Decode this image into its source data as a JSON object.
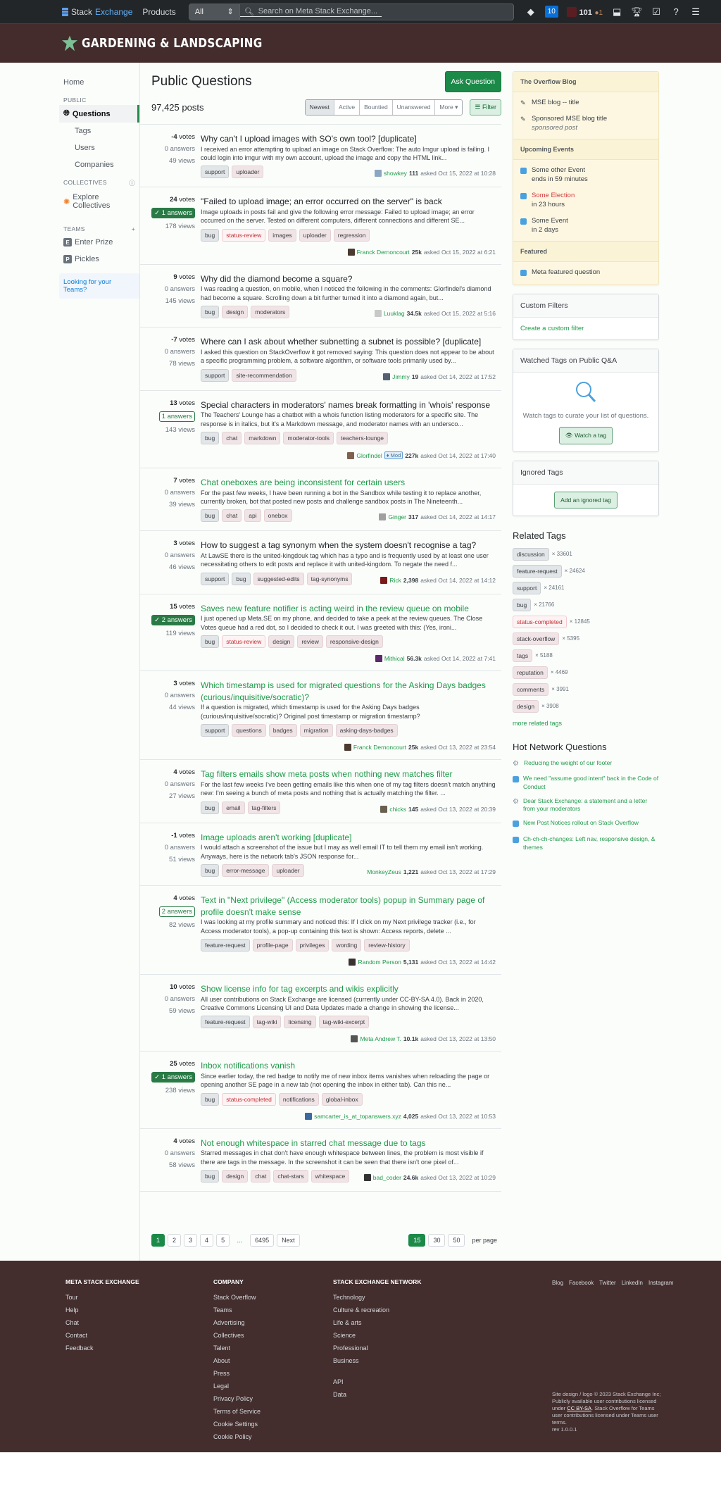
{
  "topbar": {
    "brand_a": "Stack",
    "brand_b": "Exchange",
    "products": "Products",
    "search_scope": "All",
    "search_placeholder": "Search on Meta Stack Exchange...",
    "notifications_count": "10",
    "reputation": "101",
    "bronze_badges": "1",
    "icons": [
      "diamond-icon",
      "inbox-icon",
      "achievements-icon",
      "review-icon",
      "help-icon",
      "site-switcher-icon"
    ]
  },
  "banner": {
    "site_name": "GARDENING & LANDSCAPING"
  },
  "leftnav": {
    "home": "Home",
    "public_label": "PUBLIC",
    "questions": "Questions",
    "tags": "Tags",
    "users": "Users",
    "companies": "Companies",
    "collectives_label": "COLLECTIVES",
    "explore_collectives": "Explore Collectives",
    "teams_label": "TEAMS",
    "teams": [
      {
        "icon": "E",
        "name": "Enter Prize"
      },
      {
        "icon": "P",
        "name": "Pickles"
      }
    ],
    "looking_teams": "Looking for your Teams?"
  },
  "main": {
    "title": "Public Questions",
    "ask_button": "Ask Question",
    "post_count": "97,425 posts",
    "sorts": [
      "Newest",
      "Active",
      "Bountied",
      "Unanswered",
      "More ▾"
    ],
    "active_sort": "Newest",
    "filter_button": "Filter",
    "questions": [
      {
        "votes": "-4",
        "answers": "0 answers",
        "answer_state": "none",
        "views": "49 views",
        "title": "Why can't I upload images with SO's own tool? [duplicate]",
        "visited": false,
        "excerpt": "I received an error attempting to upload an image on Stack Overflow: The auto Imgur upload is failing. I could login into imgur with my own account, upload the image and copy the HTML link...",
        "tags": [
          [
            "support",
            "g"
          ],
          [
            "uploader",
            ""
          ]
        ],
        "user": "showkey",
        "rep": "111",
        "asked": "asked Oct 15, 2022 at 10:28",
        "avatar": "#8aa6c0"
      },
      {
        "votes": "24",
        "answers": "1 answers",
        "answer_state": "accepted",
        "views": "178 views",
        "title": "\"Failed to upload image; an error occurred on the server\" is back",
        "visited": false,
        "excerpt": "Image uploads in posts fail and give the following error message: Failed to upload image; an error occurred on the server. Tested on different computers, different connections and different SE...",
        "tags": [
          [
            "bug",
            "g"
          ],
          [
            "status-review",
            "r"
          ],
          [
            "images",
            ""
          ],
          [
            "uploader",
            ""
          ],
          [
            "regression",
            ""
          ]
        ],
        "user": "Franck Dernoncourt",
        "rep": "25k",
        "asked": "asked Oct 15, 2022 at 6:21",
        "avatar": "#4a3a30"
      },
      {
        "votes": "9",
        "answers": "0 answers",
        "answer_state": "none",
        "views": "145 views",
        "title": "Why did the diamond become a square?",
        "visited": false,
        "excerpt": "I was reading a question, on mobile, when I noticed the following in the comments: Glorfindel's diamond had become a square. Scrolling down a bit further turned it into a diamond again, but...",
        "tags": [
          [
            "bug",
            "g"
          ],
          [
            "design",
            ""
          ],
          [
            "moderators",
            ""
          ]
        ],
        "user": "Luuklag",
        "rep": "34.5k",
        "asked": "asked Oct 15, 2022 at 5:16",
        "avatar": "#c8c8c8"
      },
      {
        "votes": "-7",
        "answers": "0 answers",
        "answer_state": "none",
        "views": "78 views",
        "title": "Where can I ask about whether subnetting a subnet is possible? [duplicate]",
        "visited": false,
        "excerpt": "I asked this question on StackOverflow it got removed saying: This question does not appear to be about a specific programming problem, a software algorithm, or software tools primarily used by...",
        "tags": [
          [
            "support",
            "g"
          ],
          [
            "site-recommendation",
            ""
          ]
        ],
        "user": "Jimmy",
        "rep": "19",
        "asked": "asked Oct 14, 2022 at 17:52",
        "avatar": "#556070"
      },
      {
        "votes": "13",
        "answers": "1 answers",
        "answer_state": "answered",
        "views": "143 views",
        "title": "Special characters in moderators' names break formatting in 'whois' response",
        "visited": false,
        "excerpt": "The Teachers' Lounge has a chatbot with a whois function listing moderators for a specific site. The response is in italics, but it's a Markdown message, and moderator names with an undersco...",
        "tags": [
          [
            "bug",
            "g"
          ],
          [
            "chat",
            ""
          ],
          [
            "markdown",
            ""
          ],
          [
            "moderator-tools",
            ""
          ],
          [
            "teachers-lounge",
            ""
          ]
        ],
        "user": "Glorfindel",
        "mod": "♦ Mod",
        "rep": "227k",
        "asked": "asked Oct 14, 2022 at 17:40",
        "avatar": "#806050"
      },
      {
        "votes": "7",
        "answers": "0 answers",
        "answer_state": "none",
        "views": "39 views",
        "title": "Chat oneboxes are being inconsistent for certain users",
        "visited": true,
        "excerpt": "For the past few weeks, I have been running a bot in the Sandbox while testing it to replace another, currently broken, bot that posted new posts and challenge sandbox posts in The Nineteenth...",
        "tags": [
          [
            "bug",
            "g"
          ],
          [
            "chat",
            ""
          ],
          [
            "api",
            ""
          ],
          [
            "onebox",
            ""
          ]
        ],
        "user": "Ginger",
        "rep": "317",
        "asked": "asked Oct 14, 2022 at 14:17",
        "avatar": "#a0a0a0"
      },
      {
        "votes": "3",
        "answers": "0 answers",
        "answer_state": "none",
        "views": "46 views",
        "title": "How to suggest a tag synonym when the system doesn't recognise a tag?",
        "visited": false,
        "excerpt": "At LawSE there is the united-kingdouk tag which has a typo and is frequently used by at least one user necessitating others to edit posts and replace it with united-kingdom. To negate the need f...",
        "tags": [
          [
            "support",
            "g"
          ],
          [
            "bug",
            "g"
          ],
          [
            "suggested-edits",
            ""
          ],
          [
            "tag-synonyms",
            ""
          ]
        ],
        "user": "Rick",
        "rep": "2,398",
        "asked": "asked Oct 14, 2022 at 14:12",
        "avatar": "#7a1a1a"
      },
      {
        "votes": "15",
        "answers": "2 answers",
        "answer_state": "accepted",
        "views": "119 views",
        "title": "Saves new feature notifier is acting weird in the review queue on mobile",
        "visited": true,
        "excerpt": "I just opened up Meta.SE on my phone, and decided to take a peek at the review queues. The Close Votes queue had a red dot, so I decided to check it out. I was greeted with this: (Yes, ironi...",
        "tags": [
          [
            "bug",
            "g"
          ],
          [
            "status-review",
            "r"
          ],
          [
            "design",
            ""
          ],
          [
            "review",
            ""
          ],
          [
            "responsive-design",
            ""
          ]
        ],
        "user": "Mithical",
        "rep": "56.3k",
        "asked": "asked Oct 14, 2022 at 7:41",
        "avatar": "#5a2a6a"
      },
      {
        "votes": "3",
        "answers": "0 answers",
        "answer_state": "none",
        "views": "44 views",
        "title": "Which timestamp is used for migrated questions for the Asking Days badges (curious/inquisitive/socratic)?",
        "visited": true,
        "excerpt": "If a question is migrated, which timestamp is used for the Asking Days badges (curious/inquisitive/socratic)? Original post timestamp or migration timestamp?",
        "tags": [
          [
            "support",
            "g"
          ],
          [
            "questions",
            ""
          ],
          [
            "badges",
            ""
          ],
          [
            "migration",
            ""
          ],
          [
            "asking-days-badges",
            ""
          ]
        ],
        "user": "Franck Dernoncourt",
        "rep": "25k",
        "asked": "asked Oct 13, 2022 at 23:54",
        "avatar": "#4a3a30"
      },
      {
        "votes": "4",
        "answers": "0 answers",
        "answer_state": "none",
        "views": "27 views",
        "title": "Tag filters emails show meta posts when nothing new matches filter",
        "visited": true,
        "excerpt": "For the last few weeks I've been getting emails like this when one of my tag filters doesn't match anything new: I'm seeing a bunch of meta posts and nothing that is actually matching the filter. ...",
        "tags": [
          [
            "bug",
            "g"
          ],
          [
            "email",
            ""
          ],
          [
            "tag-filters",
            ""
          ]
        ],
        "user": "chicks",
        "rep": "145",
        "asked": "asked Oct 13, 2022 at 20:39",
        "avatar": "#6a6050"
      },
      {
        "votes": "-1",
        "answers": "0 answers",
        "answer_state": "none",
        "views": "51 views",
        "title": "Image uploads aren't working [duplicate]",
        "visited": true,
        "excerpt": "I would attach a screenshot of the issue but I may as well email IT to tell them my email isn't working. Anyways, here is the network tab's JSON response for...",
        "tags": [
          [
            "bug",
            "g"
          ],
          [
            "error-message",
            ""
          ],
          [
            "uploader",
            ""
          ]
        ],
        "user": "MonkeyZeus",
        "rep": "1,221",
        "asked": "asked Oct 13, 2022 at 17:29",
        "avatar": ""
      },
      {
        "votes": "4",
        "answers": "2 answers",
        "answer_state": "answered",
        "views": "82 views",
        "title": "Text in \"Next privilege\" (Access moderator tools) popup in Summary page of profile doesn't make sense",
        "visited": true,
        "excerpt": "I was looking at my profile summary and noticed this: If I click on my Next privilege tracker (i.e., for Access moderator tools), a pop-up containing this text is shown: Access reports, delete ...",
        "tags": [
          [
            "feature-request",
            "g"
          ],
          [
            "profile-page",
            ""
          ],
          [
            "privileges",
            ""
          ],
          [
            "wording",
            ""
          ],
          [
            "review-history",
            ""
          ]
        ],
        "user": "Random Person",
        "rep": "5,131",
        "asked": "asked Oct 13, 2022 at 14:42",
        "avatar": "#3a3030"
      },
      {
        "votes": "10",
        "answers": "0 answers",
        "answer_state": "none",
        "views": "59 views",
        "title": "Show license info for tag excerpts and wikis explicitly",
        "visited": true,
        "excerpt": "All user contributions on Stack Exchange are licensed (currently under CC-BY-SA 4.0). Back in 2020, Creative Commons Licensing UI and Data Updates made a change in showing the license...",
        "tags": [
          [
            "feature-request",
            "g"
          ],
          [
            "tag-wiki",
            ""
          ],
          [
            "licensing",
            ""
          ],
          [
            "tag-wiki-excerpt",
            ""
          ]
        ],
        "user": "Meta Andrew T.",
        "rep": "10.1k",
        "asked": "asked Oct 13, 2022 at 13:50",
        "avatar": "#555"
      },
      {
        "votes": "25",
        "answers": "1 answers",
        "answer_state": "accepted",
        "views": "238 views",
        "title": "Inbox notifications vanish",
        "visited": true,
        "excerpt": "Since earlier today, the red badge to notify me of new inbox items vanishes when reloading the page or opening another SE page in a new tab (not opening the inbox in either tab). Can this ne...",
        "tags": [
          [
            "bug",
            "g"
          ],
          [
            "status-completed",
            "r"
          ],
          [
            "notifications",
            ""
          ],
          [
            "global-inbox",
            ""
          ]
        ],
        "user": "samcarter_is_at_topanswers.xyz",
        "rep": "4,025",
        "asked": "asked Oct 13, 2022 at 10:53",
        "avatar": "#3a6aa0"
      },
      {
        "votes": "4",
        "answers": "0 answers",
        "answer_state": "none",
        "views": "58 views",
        "title": "Not enough whitespace in starred chat message due to tags",
        "visited": true,
        "excerpt": "Starred messages in chat don't have enough whitespace between lines, the problem is most visible if there are tags in the message. In the screenshot it can be seen that there isn't one pixel of...",
        "tags": [
          [
            "bug",
            "g"
          ],
          [
            "design",
            ""
          ],
          [
            "chat",
            ""
          ],
          [
            "chat-stars",
            ""
          ],
          [
            "whitespace",
            ""
          ]
        ],
        "user": "bad_coder",
        "rep": "24.6k",
        "asked": "asked Oct 13, 2022 at 10:29",
        "avatar": "#333"
      }
    ],
    "pagination": {
      "pages": [
        "1",
        "2",
        "3",
        "4",
        "5",
        "…",
        "6495",
        "Next"
      ],
      "current": "1",
      "per_page": [
        "15",
        "30",
        "50"
      ],
      "per_page_current": "15",
      "per_page_label": "per page"
    }
  },
  "right": {
    "blog_header": "The Overflow Blog",
    "blog": [
      {
        "title": "MSE blog -- title"
      },
      {
        "title": "Sponsored MSE blog title",
        "sub": "sponsored post"
      }
    ],
    "events_header": "Upcoming Events",
    "events": [
      {
        "title": "Some other Event",
        "sub": "ends in 59 minutes",
        "red": false
      },
      {
        "title": "Some Election",
        "sub": "in 23 hours",
        "red": true
      },
      {
        "title": "Some Event",
        "sub": "in 2 days",
        "red": false
      }
    ],
    "featured_header": "Featured",
    "featured": [
      "Meta featured question"
    ],
    "custom_filters": {
      "header": "Custom Filters",
      "link": "Create a custom filter"
    },
    "watched": {
      "header": "Watched Tags on Public Q&A",
      "text": "Watch tags to curate your list of questions.",
      "button": "Watch a tag"
    },
    "ignored": {
      "header": "Ignored Tags",
      "button": "Add an ignored tag"
    },
    "related_header": "Related Tags",
    "related": [
      {
        "tag": "discussion",
        "count": "× 33601",
        "style": "g"
      },
      {
        "tag": "feature-request",
        "count": "× 24624",
        "style": "g"
      },
      {
        "tag": "support",
        "count": "× 24161",
        "style": "g"
      },
      {
        "tag": "bug",
        "count": "× 21766",
        "style": "g"
      },
      {
        "tag": "status-completed",
        "count": "× 12845",
        "style": "r"
      },
      {
        "tag": "stack-overflow",
        "count": "× 5395",
        "style": ""
      },
      {
        "tag": "tags",
        "count": "× 5188",
        "style": ""
      },
      {
        "tag": "reputation",
        "count": "× 4469",
        "style": ""
      },
      {
        "tag": "comments",
        "count": "× 3991",
        "style": ""
      },
      {
        "tag": "design",
        "count": "× 3908",
        "style": ""
      }
    ],
    "more_related": "more related tags",
    "hot_header": "Hot Network Questions",
    "hot": [
      {
        "icon": "gear",
        "text": "Reducing the weight of our footer"
      },
      {
        "icon": "chat",
        "text": "We need \"assume good intent\" back in the Code of Conduct"
      },
      {
        "icon": "gear",
        "text": "Dear Stack Exchange: a statement and a letter from your moderators"
      },
      {
        "icon": "chat",
        "text": "New Post Notices rollout on Stack Overflow"
      },
      {
        "icon": "chat",
        "text": "Ch-ch-ch-changes: Left nav, responsive design, & themes"
      }
    ]
  },
  "footer": {
    "col1": {
      "title": "META STACK EXCHANGE",
      "links": [
        "Tour",
        "Help",
        "Chat",
        "Contact",
        "Feedback"
      ]
    },
    "col2": {
      "title": "COMPANY",
      "links": [
        "Stack Overflow",
        "Teams",
        "Advertising",
        "Collectives",
        "Talent",
        "About",
        "Press",
        "Legal",
        "Privacy Policy",
        "Terms of Service",
        "Cookie Settings",
        "Cookie Policy"
      ]
    },
    "col3": {
      "title": "STACK EXCHANGE NETWORK",
      "links": [
        "Technology",
        "Culture & recreation",
        "Life & arts",
        "Science",
        "Professional",
        "Business"
      ],
      "links2": [
        "API",
        "Data"
      ]
    },
    "social": [
      "Blog",
      "Facebook",
      "Twitter",
      "LinkedIn",
      "Instagram"
    ],
    "copy_a": "Site design / logo © 2023 Stack Exchange Inc; Publicly available user contributions licensed under ",
    "copy_link": "CC BY-SA",
    "copy_b": ". Stack Overflow for Teams user contributions licensed under Teams user terms.",
    "rev": "rev 1.0.0.1"
  }
}
